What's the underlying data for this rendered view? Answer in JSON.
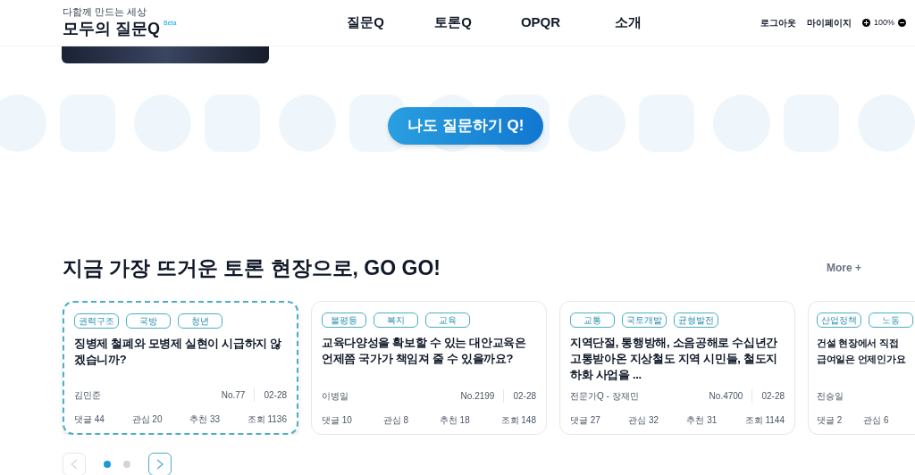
{
  "header": {
    "tagline": "다함께 만드는 세상",
    "logo": "모두의 질문Q",
    "badge": "Beta",
    "nav": [
      {
        "label": "질문Q"
      },
      {
        "label": "토론Q"
      },
      {
        "label": "OPQR"
      },
      {
        "label": "소개"
      }
    ],
    "links": [
      "로그아웃",
      "마이페이지"
    ],
    "zoom": "100%"
  },
  "hero": {
    "button": "나도 질문하기 Q!"
  },
  "section": {
    "title": "지금 가장 뜨거운 토론 현장으로, GO GO!",
    "more": "More +",
    "cards": [
      {
        "selected": true,
        "tags": [
          "권력구조",
          "국방",
          "청년"
        ],
        "title": "징병제 철폐와 모병제 실현이 시급하지 않겠습니까?",
        "author": "김민준",
        "no": "No.77",
        "date": "02-28",
        "stats": [
          "댓글 44",
          "관심 20",
          "추천 33",
          "조회 1136"
        ]
      },
      {
        "selected": false,
        "tags": [
          "불평등",
          "복지",
          "교육"
        ],
        "title": "교육다양성을 확보할 수 있는 대안교육은 언제쯤 국가가 책임져 줄 수 있을까요?",
        "author": "이병일",
        "no": "No.2199",
        "date": "02-28",
        "stats": [
          "댓글 10",
          "관심 8",
          "추천 18",
          "조회 148"
        ]
      },
      {
        "selected": false,
        "tags": [
          "교통",
          "국토개발",
          "균형발전"
        ],
        "title": "지역단절, 통행방해, 소음공해로 수십년간 고통받아온 지상철도 지역 시민들, 철도지하화 사업을 ...",
        "author": "전문가Q - 장재민",
        "no": "No.4700",
        "date": "02-28",
        "stats": [
          "댓글 27",
          "관심 32",
          "추천 31",
          "조회 1144"
        ]
      },
      {
        "selected": false,
        "tags": [
          "산업정책",
          "노동"
        ],
        "title": "건설 현장에서 직접\n급여일은 언제인가요",
        "author": "전승일",
        "stats": [
          "댓글 2",
          "관심 6"
        ]
      }
    ],
    "pages": [
      {
        "selected": true
      },
      {
        "selected": false
      }
    ],
    "prev": {
      "disabled": true
    },
    "next": {
      "disabled": false
    }
  }
}
